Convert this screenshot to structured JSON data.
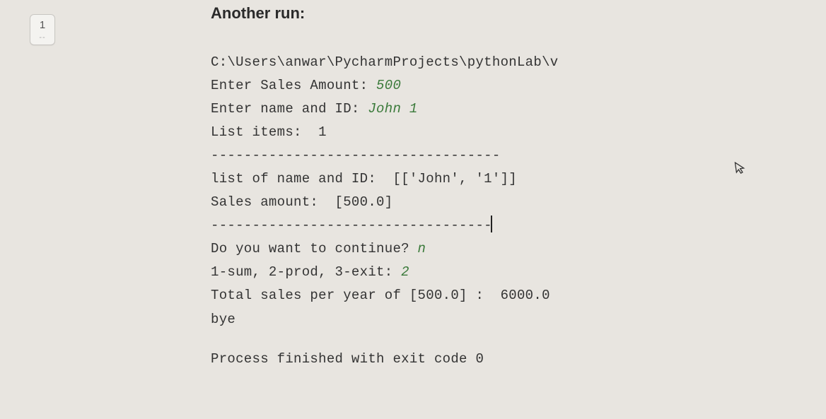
{
  "sidebar": {
    "page_number": "1",
    "sep": "--"
  },
  "heading": "Another run:",
  "console": {
    "l1": "C:\\Users\\anwar\\PycharmProjects\\pythonLab\\v",
    "l2a": "Enter Sales Amount: ",
    "l2b": "500",
    "l3a": "Enter name and ID: ",
    "l3b": "John 1",
    "l4": "List items:  1",
    "l5": "-----------------------------------",
    "l6": "list of name and ID:  [['John', '1']]",
    "l7": "Sales amount:  [500.0]",
    "l8": "----------------------------------",
    "l9a": "Do you want to continue? ",
    "l9b": "n",
    "l10a": "1-sum, 2-prod, 3-exit: ",
    "l10b": "2",
    "l11": "Total sales per year of [500.0] :  6000.0",
    "l12": "bye"
  },
  "exit": "Process finished with exit code 0"
}
